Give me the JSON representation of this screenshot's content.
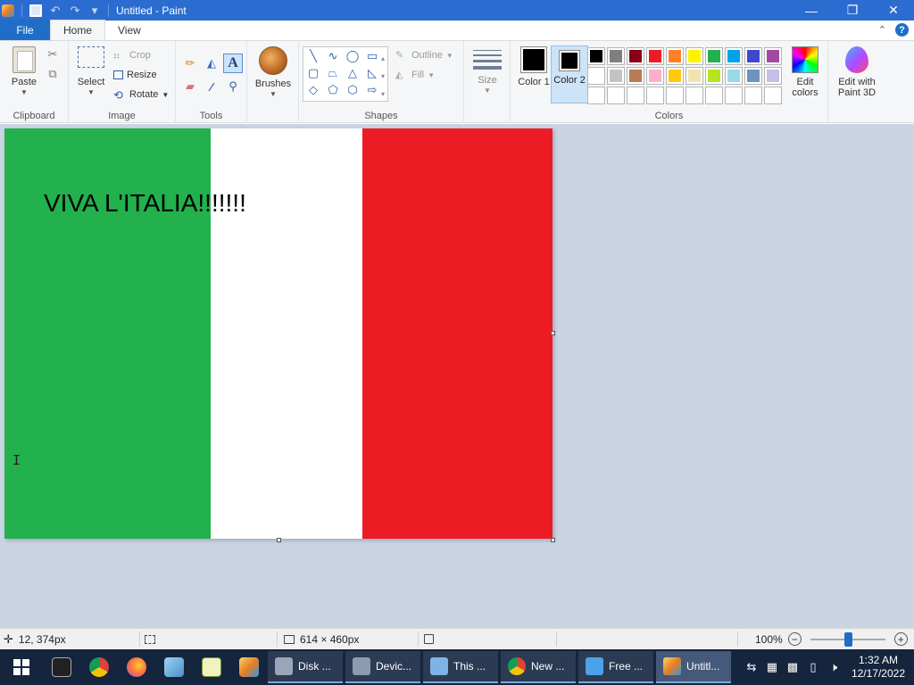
{
  "window": {
    "title": "Untitled - Paint",
    "minimize_glyph": "—",
    "maximize_glyph": "❐",
    "close_glyph": "✕"
  },
  "quick_access": {
    "undo_glyph": "↶",
    "redo_glyph": "↷",
    "customize_glyph": "▾"
  },
  "tabs": {
    "file": "File",
    "home": "Home",
    "view": "View",
    "collapse_glyph": "⌃",
    "help_glyph": "?"
  },
  "ribbon": {
    "clipboard": {
      "label": "Clipboard",
      "paste": "Paste",
      "cut_glyph": "✂",
      "copy_glyph": "⧉"
    },
    "image": {
      "label": "Image",
      "select": "Select",
      "crop": "Crop",
      "resize": "Resize",
      "rotate": "Rotate"
    },
    "tools": {
      "label": "Tools",
      "pencil_glyph": "✏",
      "fill_glyph": "◭",
      "text_glyph": "A",
      "eraser_glyph": "▰",
      "picker_glyph": "⁄",
      "magnifier_glyph": "⚲"
    },
    "brushes": {
      "label": "Brushes"
    },
    "shapes": {
      "label": "Shapes",
      "outline": "Outline",
      "fill": "Fill",
      "glyphs": [
        "╲",
        "∿",
        "◯",
        "▭",
        "▢",
        "⏢",
        "△",
        "◺",
        "◇",
        "⬠",
        "⬡",
        "⇨"
      ]
    },
    "size": {
      "label": "Size"
    },
    "colors": {
      "label": "Colors",
      "color1_label": "Color 1",
      "color2_label": "Color 2",
      "color1": "#000000",
      "color2": "#000000",
      "edit_colors": "Edit colors",
      "paint3d": "Edit with Paint 3D",
      "palette_row1": [
        "#000000",
        "#7f7f7f",
        "#880015",
        "#ed1c24",
        "#ff7f27",
        "#fff200",
        "#22b14c",
        "#00a2e8",
        "#3f48cc",
        "#a349a4"
      ],
      "palette_row2": [
        "#ffffff",
        "#c3c3c3",
        "#b97a57",
        "#ffaec9",
        "#ffc90e",
        "#efe4b0",
        "#b5e61d",
        "#99d9ea",
        "#7092be",
        "#c8bfe7"
      ],
      "palette_row3": [
        "#ffffff",
        "#ffffff",
        "#ffffff",
        "#ffffff",
        "#ffffff",
        "#ffffff",
        "#ffffff",
        "#ffffff",
        "#ffffff",
        "#ffffff"
      ]
    }
  },
  "canvas": {
    "text": "VIVA L'ITALIA!!!!!!!",
    "stripe_colors": [
      "#22b14c",
      "#ffffff",
      "#ed1c24"
    ]
  },
  "status": {
    "cursor_pos": "12, 374px",
    "canvas_size": "614 × 460px",
    "zoom": "100%"
  },
  "taskbar": {
    "items": [
      {
        "label": "Disk ...",
        "icon": "disk-manager-icon"
      },
      {
        "label": "Devic...",
        "icon": "device-manager-icon"
      },
      {
        "label": "This ...",
        "icon": "this-pc-icon"
      },
      {
        "label": "New ...",
        "icon": "chrome-icon"
      },
      {
        "label": "Free ...",
        "icon": "free-app-icon"
      },
      {
        "label": "Untitl...",
        "icon": "paint-icon"
      }
    ],
    "time": "1:32 AM",
    "date": "12/17/2022"
  }
}
